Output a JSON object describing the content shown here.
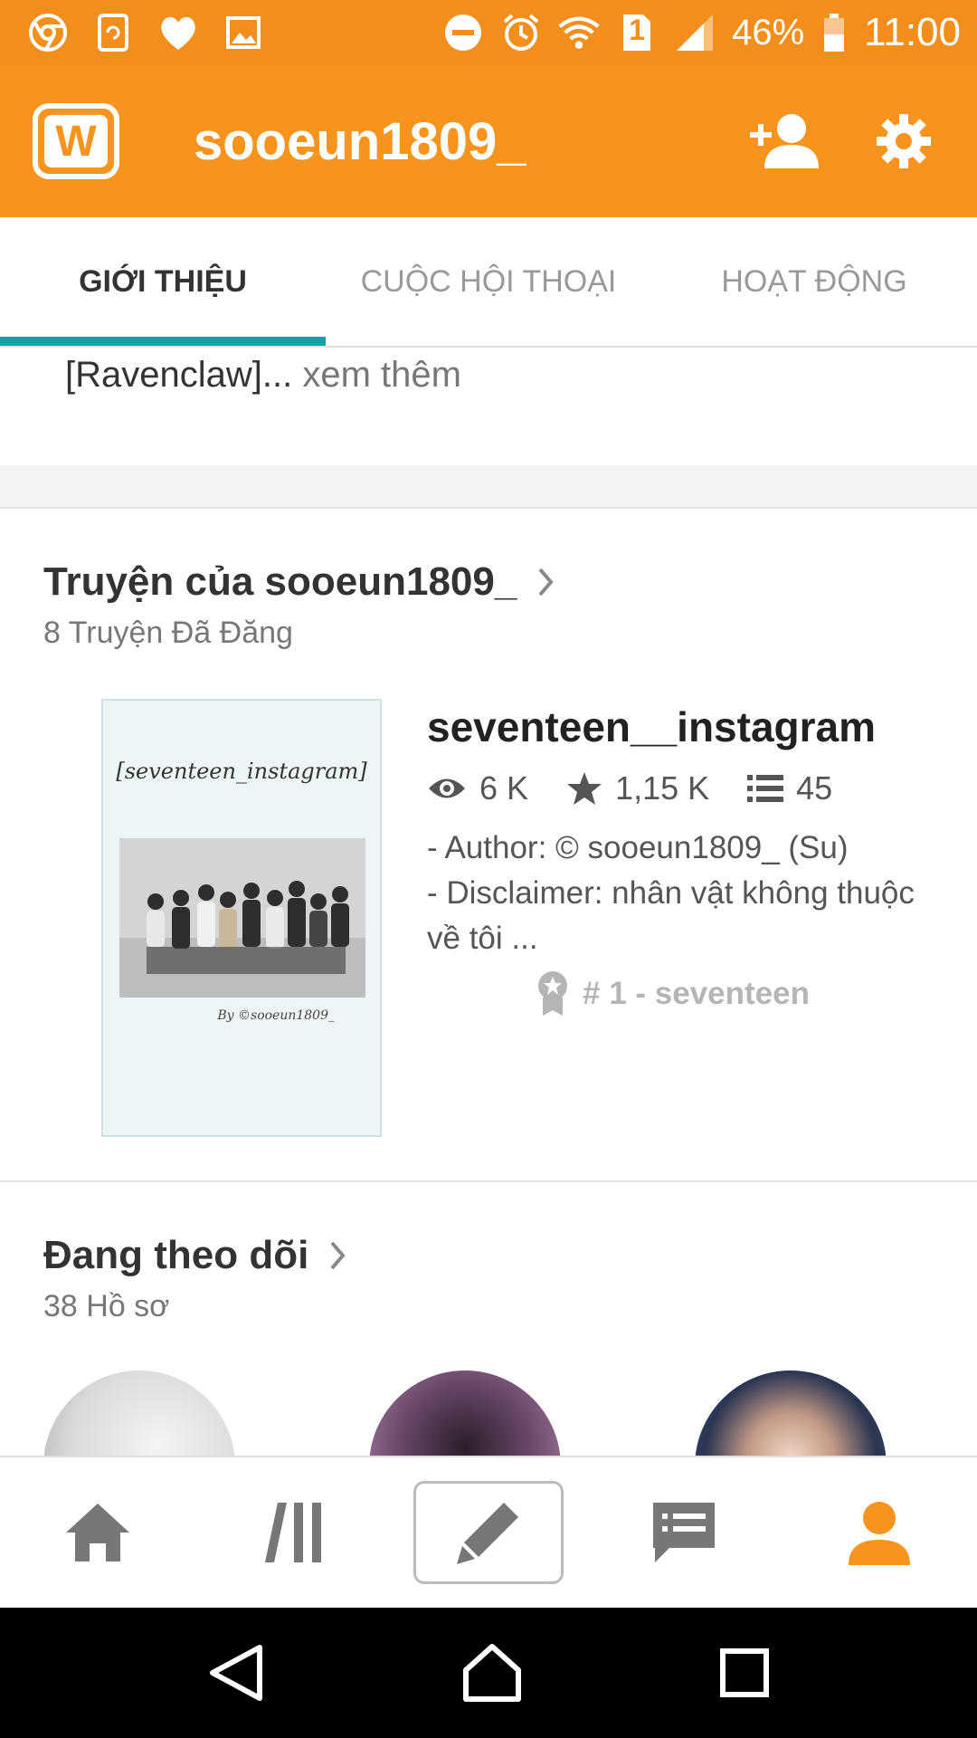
{
  "status_bar": {
    "battery": "46%",
    "time": "11:00",
    "sim": "1",
    "icons": [
      "chrome-icon",
      "sync-icon",
      "heart-icon",
      "image-icon",
      "do-not-disturb-icon",
      "alarm-icon",
      "wifi-icon",
      "sim-icon",
      "signal-icon",
      "battery-icon"
    ]
  },
  "app_bar": {
    "logo": "W",
    "title": "sooeun1809_",
    "actions": [
      "add-person-icon",
      "settings-icon"
    ]
  },
  "tabs": [
    {
      "label": "GIỚI THIỆU",
      "active": true
    },
    {
      "label": "CUỘC HỘI THOẠI",
      "active": false
    },
    {
      "label": "HOẠT ĐỘNG",
      "active": false
    }
  ],
  "about": {
    "text": "[Ravenclaw]...",
    "more": " xem thêm"
  },
  "stories_section": {
    "title": "Truyện của sooeun1809_",
    "subtitle": "8 Truyện Đã Đăng",
    "story": {
      "cover_title": "[seventeen_instagram]",
      "cover_by": "By ©sooeun1809_",
      "title": "seventeen__instagram",
      "reads": "6 K",
      "votes": "1,15 K",
      "parts": "45",
      "desc_line1": "- Author: © sooeun1809_ (Su)",
      "desc_line2": "- Disclaimer: nhân vật không thuộc về tôi ...",
      "tag": "# 1 - seventeen"
    }
  },
  "following_section": {
    "title": "Đang theo dõi",
    "subtitle": "38 Hồ sơ"
  },
  "bottom_nav": [
    "home-icon",
    "library-icon",
    "write-icon",
    "messages-icon",
    "profile-icon"
  ],
  "colors": {
    "status_bar": "#f28f1c",
    "app_bar": "#f7941d",
    "tab_indicator": "#0fa3a8",
    "active_nav": "#f7941d"
  }
}
